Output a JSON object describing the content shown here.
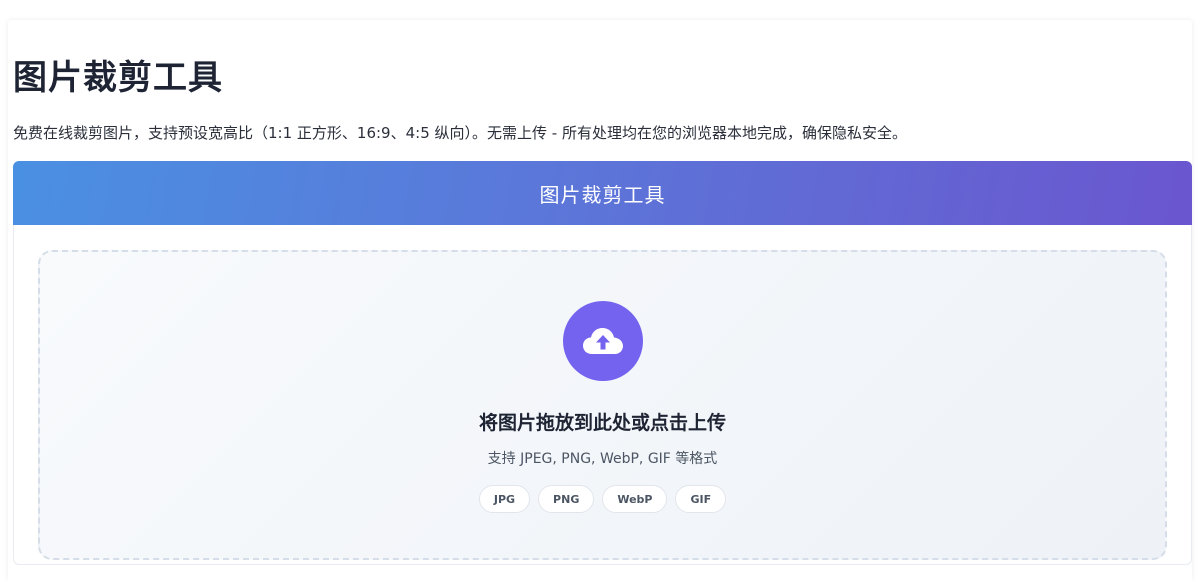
{
  "page": {
    "title": "图片裁剪工具",
    "description": "免费在线裁剪图片，支持预设宽高比（1:1 正方形、16:9、4:5 纵向）。无需上传 - 所有处理均在您的浏览器本地完成，确保隐私安全。"
  },
  "tool": {
    "header_title": "图片裁剪工具",
    "dropzone": {
      "icon": "cloud-upload-icon",
      "title": "将图片拖放到此处或点击上传",
      "subtitle": "支持 JPEG, PNG, WebP, GIF 等格式",
      "formats": [
        "JPG",
        "PNG",
        "WebP",
        "GIF"
      ]
    }
  },
  "colors": {
    "header_gradient_start": "#4a90e2",
    "header_gradient_end": "#6a56cf",
    "upload_icon_bg": "#7463ef"
  }
}
